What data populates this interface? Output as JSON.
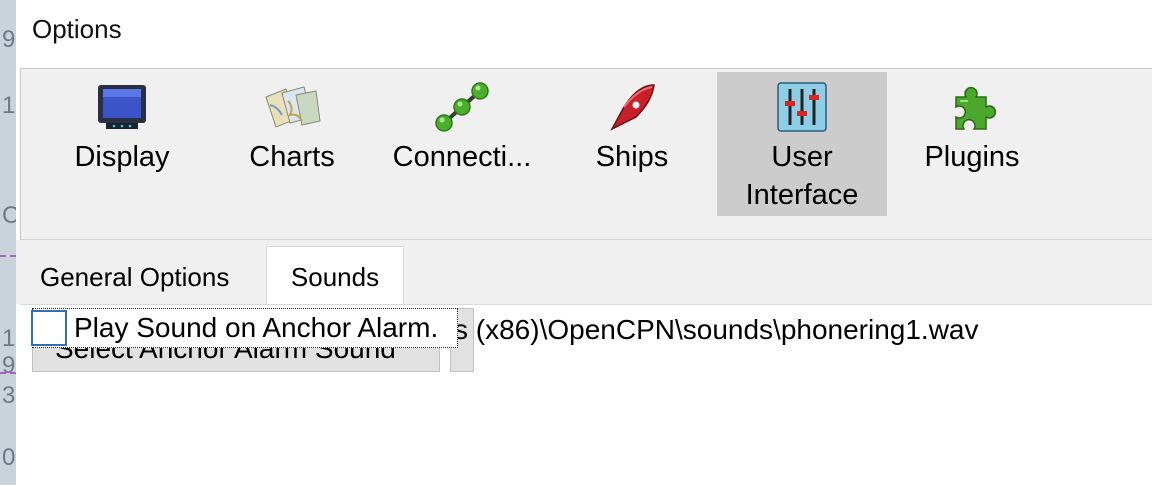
{
  "window": {
    "title": "Options"
  },
  "background_strip": [
    "9",
    "1",
    "C",
    "1",
    "9",
    "3",
    "0"
  ],
  "toolbar": {
    "buttons": [
      {
        "label": "Display",
        "icon": "monitor-icon",
        "selected": false
      },
      {
        "label": "Charts",
        "icon": "charts-icon",
        "selected": false
      },
      {
        "label": "Connecti...",
        "icon": "connections-icon",
        "selected": false
      },
      {
        "label": "Ships",
        "icon": "ship-icon",
        "selected": false
      },
      {
        "label": "User\nInterface",
        "icon": "sliders-icon",
        "selected": true
      },
      {
        "label": "Plugins",
        "icon": "puzzle-icon",
        "selected": false
      }
    ]
  },
  "tabs": [
    {
      "label": "General Options",
      "active": false
    },
    {
      "label": "Sounds",
      "active": true
    }
  ],
  "sounds": {
    "select_button_label": "Select Anchor Alarm Sound",
    "sound_path": "s (x86)\\OpenCPN\\sounds\\phonering1.wav",
    "anchor_alarm_checkbox_label": "Play Sound on Anchor Alarm.",
    "anchor_alarm_checked": false
  },
  "colors": {
    "selected_button": "#cccccc",
    "checkbox_border": "#2f6fb6",
    "toolbar_bg": "#f0f0f0"
  }
}
